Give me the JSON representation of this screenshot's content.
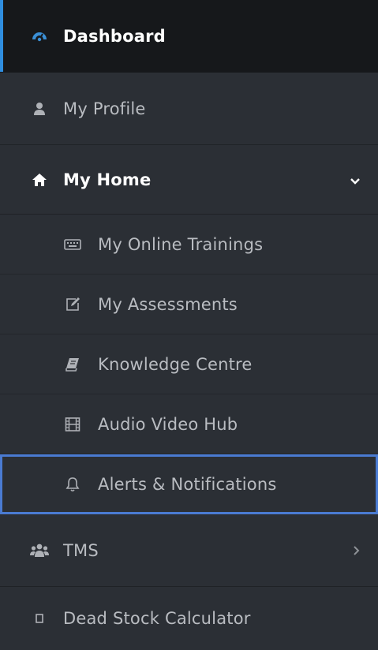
{
  "sidebar": {
    "items": [
      {
        "label": "Dashboard",
        "icon": "dashboard-gauge-icon",
        "state": "active"
      },
      {
        "label": "My Profile",
        "icon": "user-icon"
      },
      {
        "label": "My Home",
        "icon": "home-icon",
        "state": "expanded",
        "children": [
          {
            "label": "My Online Trainings",
            "icon": "keyboard-icon"
          },
          {
            "label": "My Assessments",
            "icon": "edit-icon"
          },
          {
            "label": "Knowledge Centre",
            "icon": "book-icon"
          },
          {
            "label": "Audio Video Hub",
            "icon": "film-icon"
          },
          {
            "label": "Alerts & Notifications",
            "icon": "bell-icon",
            "state": "selected"
          }
        ]
      },
      {
        "label": "TMS",
        "icon": "users-icon",
        "state": "collapsed"
      },
      {
        "label": "Dead Stock Calculator",
        "icon": "square-icon"
      }
    ]
  },
  "colors": {
    "sidebar_bg": "#2b2f35",
    "active_bg": "#16181b",
    "accent": "#2f8ee0",
    "selected_border": "#4a7bd2",
    "text": "#b9bcc1",
    "text_active": "#ffffff"
  }
}
